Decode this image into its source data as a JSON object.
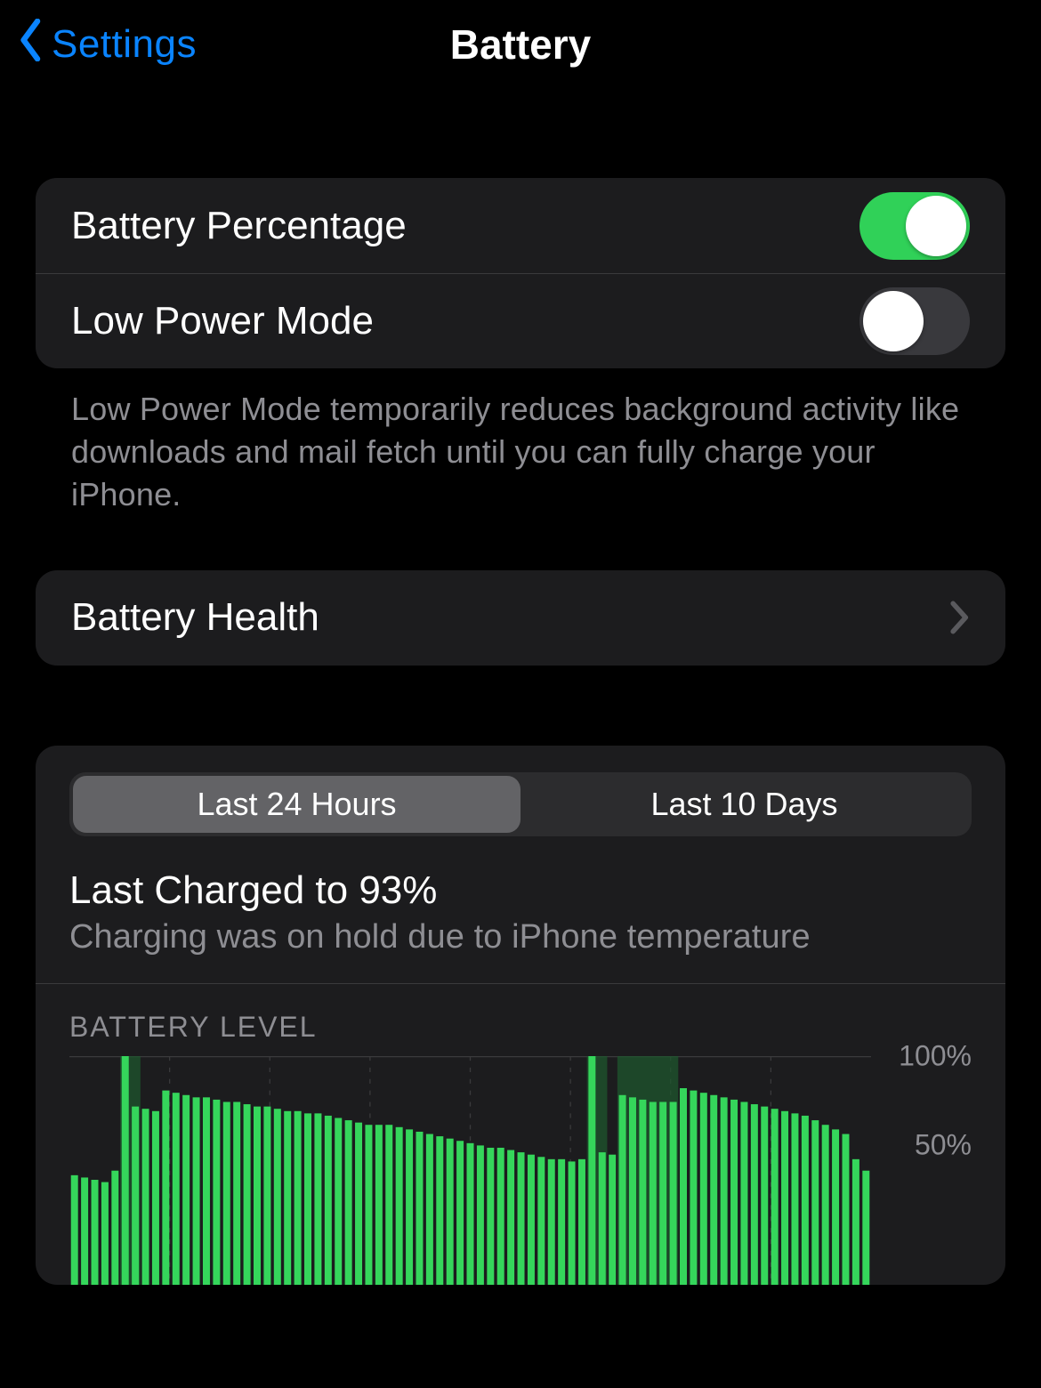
{
  "nav": {
    "back_label": "Settings",
    "title": "Battery"
  },
  "toggles": {
    "battery_percentage_label": "Battery Percentage",
    "battery_percentage_on": true,
    "low_power_label": "Low Power Mode",
    "low_power_on": false,
    "low_power_note": "Low Power Mode temporarily reduces background activity like downloads and mail fetch until you can fully charge your iPhone."
  },
  "health": {
    "label": "Battery Health"
  },
  "usage": {
    "seg_a": "Last 24 Hours",
    "seg_b": "Last 10 Days",
    "last_charged_title": "Last Charged to 93%",
    "last_charged_sub": "Charging was on hold due to iPhone temperature",
    "chart_label": "BATTERY LEVEL",
    "y_ticks": [
      "100%",
      "50%"
    ]
  },
  "chart_data": {
    "type": "bar",
    "title": "BATTERY LEVEL",
    "ylabel": "%",
    "ylim": [
      0,
      100
    ],
    "values": [
      48,
      47,
      46,
      45,
      50,
      100,
      78,
      77,
      76,
      85,
      84,
      83,
      82,
      82,
      81,
      80,
      80,
      79,
      78,
      78,
      77,
      76,
      76,
      75,
      75,
      74,
      73,
      72,
      71,
      70,
      70,
      70,
      69,
      68,
      67,
      66,
      65,
      64,
      63,
      62,
      61,
      60,
      60,
      59,
      58,
      57,
      56,
      55,
      55,
      54,
      55,
      100,
      58,
      57,
      83,
      82,
      81,
      80,
      80,
      80,
      86,
      85,
      84,
      83,
      82,
      81,
      80,
      79,
      78,
      77,
      76,
      75,
      74,
      72,
      70,
      68,
      66,
      55,
      50
    ],
    "charging_spans": [
      [
        5,
        7
      ],
      [
        51,
        53
      ],
      [
        54,
        60
      ]
    ]
  }
}
